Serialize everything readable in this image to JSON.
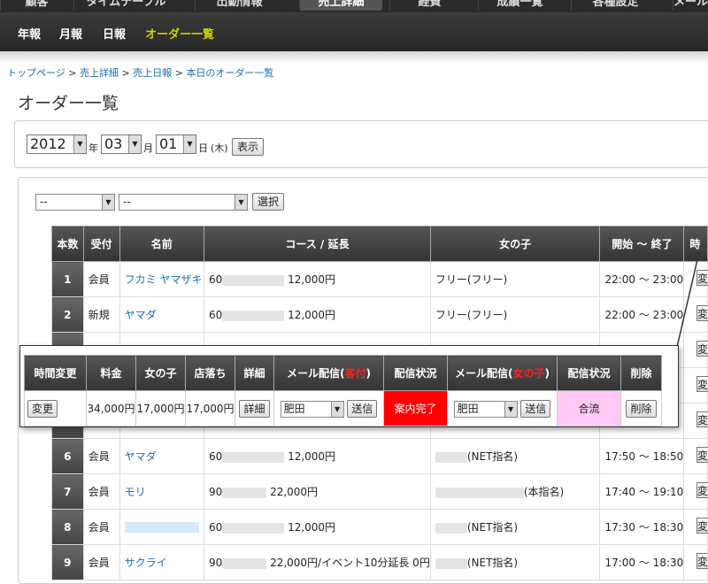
{
  "topnav": {
    "tabs": [
      "顧客",
      "タイムテーブル",
      "出勤情報",
      "売上詳細",
      "経費",
      "成績一覧",
      "各種設定",
      "メール"
    ]
  },
  "subnav": {
    "items": [
      "年報",
      "月報",
      "日報",
      "オーダー一覧"
    ]
  },
  "breadcrumb": {
    "items": [
      "トップページ",
      "売上詳細",
      "売上日報",
      "本日のオーダー一覧"
    ],
    "sep": ">"
  },
  "page_title": "オーダー一覧",
  "date": {
    "year": "2012",
    "year_unit": "年",
    "month": "03",
    "month_unit": "月",
    "day": "01",
    "day_unit": "日",
    "weekday": "(木)",
    "show_button": "表示"
  },
  "filter": {
    "select1": "--",
    "select2": "--",
    "button": "選択"
  },
  "table": {
    "headers": [
      "本数",
      "受付",
      "名前",
      "コース / 延長",
      "女の子",
      "開始 〜 終了",
      "時"
    ],
    "rows": [
      {
        "num": "1",
        "uketsuke": "会員",
        "name": "フカミ ヤマザキ",
        "course_prefix": "60",
        "course_suffix": "12,000円",
        "girl": "フリー(フリー)",
        "girl_blurred": false,
        "time": "22:00 〜 23:00"
      },
      {
        "num": "2",
        "uketsuke": "新規",
        "name": "ヤマダ",
        "course_prefix": "60",
        "course_suffix": "12,000円",
        "girl": "フリー(フリー)",
        "girl_blurred": false,
        "time": "22:00 〜 23:00"
      },
      {
        "num": "6",
        "uketsuke": "会員",
        "name": "ヤマダ",
        "course_prefix": "60",
        "course_suffix": "12,000円",
        "girl": "(NET指名)",
        "girl_blurred": true,
        "time": "17:50 〜 18:50"
      },
      {
        "num": "7",
        "uketsuke": "会員",
        "name": "モリ",
        "course_prefix": "90",
        "course_suffix": "22,000円",
        "girl": "(本指名)",
        "girl_blurred": true,
        "time": "17:40 〜 19:10"
      },
      {
        "num": "8",
        "uketsuke": "会員",
        "name": "",
        "course_prefix": "60",
        "course_suffix": "12,000円",
        "girl": "(NET指名)",
        "girl_blurred": true,
        "time": "17:30 〜 18:30"
      },
      {
        "num": "9",
        "uketsuke": "会員",
        "name": "サクライ",
        "course_prefix": "90",
        "course_suffix": "22,000円/イベント10分延長 0円",
        "girl": "(NET指名)",
        "girl_blurred": true,
        "time": "17:00 〜 18:30"
      }
    ],
    "side_button": "変"
  },
  "popup": {
    "headers": [
      "時間変更",
      "料金",
      "女の子",
      "店落ち",
      "詳細",
      "メール配信(",
      "客付",
      ")",
      "配信状況",
      "メール配信(",
      "女の子",
      ")",
      "配信状況",
      "削除"
    ],
    "row": {
      "change_button": "変更",
      "price": "34,000円",
      "girl_fee": "17,000円",
      "shop_fee": "17,000円",
      "detail_button": "詳細",
      "mail1_select": "肥田",
      "send1_button": "送信",
      "status1": "案内完了",
      "mail2_select": "肥田",
      "send2_button": "送信",
      "status2": "合流",
      "delete_button": "削除"
    }
  },
  "colors": {
    "status1_bg": "#ff0000",
    "status2_bg": "#ffc8f5",
    "link": "#1a6fb3",
    "subnav_active": "#c9d400"
  }
}
